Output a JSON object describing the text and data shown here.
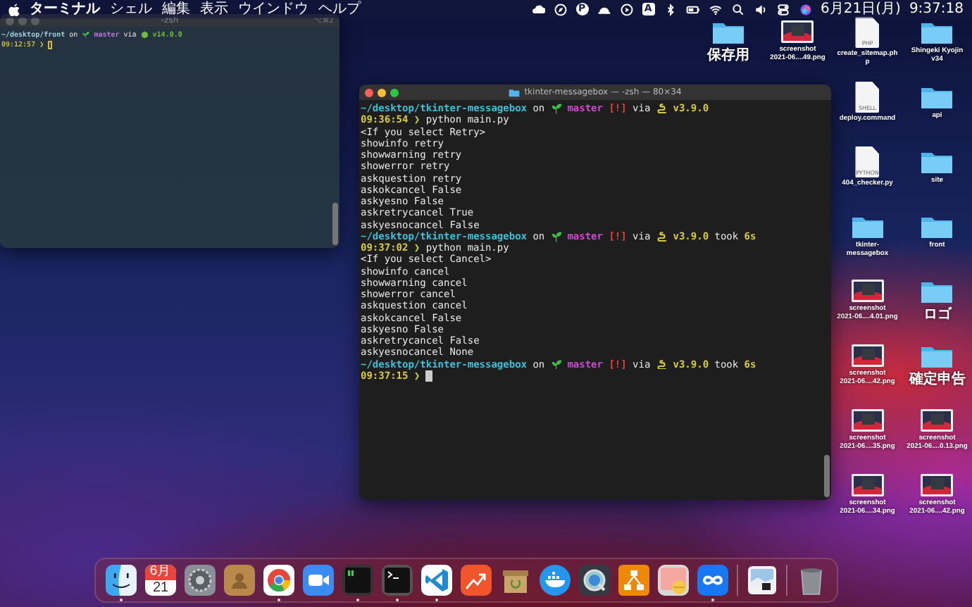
{
  "menubar": {
    "app": "ターミナル",
    "menus": [
      "シェル",
      "編集",
      "表示",
      "ウインドウ",
      "ヘルプ"
    ],
    "status_glyphs": [
      "P",
      "A"
    ],
    "date": "6月21日(月)",
    "time": "9:37:18"
  },
  "windows": [
    {
      "title": "-zsh",
      "shortcut": "⌥⌘2",
      "active": false,
      "lines": [
        [
          {
            "kind": "path",
            "text": "~/desktop/front"
          },
          {
            "kind": "plain",
            "text": "on"
          },
          {
            "kind": "sprout"
          },
          {
            "kind": "branch",
            "text": "master"
          },
          {
            "kind": "plain",
            "text": "via"
          },
          {
            "kind": "nodejs"
          },
          {
            "kind": "node",
            "text": "v14.0.0"
          }
        ],
        [
          {
            "kind": "time",
            "text": "09:12:57"
          },
          {
            "kind": "prompt",
            "text": "❯"
          },
          {
            "kind": "cursor"
          }
        ]
      ]
    },
    {
      "title": "tkinter-messagebox — -zsh — 80×34",
      "active": true,
      "lines": [
        [
          {
            "kind": "path",
            "text": "~/desktop/tkinter-messagebox"
          },
          {
            "kind": "plain",
            "text": "on"
          },
          {
            "kind": "sprout"
          },
          {
            "kind": "branch",
            "text": "master"
          },
          {
            "kind": "status",
            "text": "[!]"
          },
          {
            "kind": "plain",
            "text": "via"
          },
          {
            "kind": "python"
          },
          {
            "kind": "version",
            "text": "v3.9.0"
          }
        ],
        [
          {
            "kind": "time",
            "text": "09:36:54"
          },
          {
            "kind": "prompt",
            "text": "❯"
          },
          {
            "kind": "command",
            "text": "python main.py"
          }
        ],
        [
          {
            "kind": "output",
            "text": "<If you select Retry>"
          }
        ],
        [
          {
            "kind": "output",
            "text": "showinfo retry"
          }
        ],
        [
          {
            "kind": "output",
            "text": "showwarning retry"
          }
        ],
        [
          {
            "kind": "output",
            "text": "showerror retry"
          }
        ],
        [
          {
            "kind": "output",
            "text": "askquestion retry"
          }
        ],
        [
          {
            "kind": "output",
            "text": "askokcancel False"
          }
        ],
        [
          {
            "kind": "output",
            "text": "askyesno False"
          }
        ],
        [
          {
            "kind": "output",
            "text": "askretrycancel True"
          }
        ],
        [
          {
            "kind": "output",
            "text": "askyesnocancel False"
          }
        ],
        [
          {
            "kind": "path",
            "text": "~/desktop/tkinter-messagebox"
          },
          {
            "kind": "plain",
            "text": "on"
          },
          {
            "kind": "sprout"
          },
          {
            "kind": "branch",
            "text": "master"
          },
          {
            "kind": "status",
            "text": "[!]"
          },
          {
            "kind": "plain",
            "text": "via"
          },
          {
            "kind": "python"
          },
          {
            "kind": "version",
            "text": "v3.9.0"
          },
          {
            "kind": "plain",
            "text": "took"
          },
          {
            "kind": "duration",
            "text": "6s"
          }
        ],
        [
          {
            "kind": "time",
            "text": "09:37:02"
          },
          {
            "kind": "prompt",
            "text": "❯"
          },
          {
            "kind": "command",
            "text": "python main.py"
          }
        ],
        [
          {
            "kind": "output",
            "text": "<If you select Cancel>"
          }
        ],
        [
          {
            "kind": "output",
            "text": "showinfo cancel"
          }
        ],
        [
          {
            "kind": "output",
            "text": "showwarning cancel"
          }
        ],
        [
          {
            "kind": "output",
            "text": "showerror cancel"
          }
        ],
        [
          {
            "kind": "output",
            "text": "askquestion cancel"
          }
        ],
        [
          {
            "kind": "output",
            "text": "askokcancel False"
          }
        ],
        [
          {
            "kind": "output",
            "text": "askyesno False"
          }
        ],
        [
          {
            "kind": "output",
            "text": "askretrycancel False"
          }
        ],
        [
          {
            "kind": "output",
            "text": "askyesnocancel None"
          }
        ],
        [
          {
            "kind": "path",
            "text": "~/desktop/tkinter-messagebox"
          },
          {
            "kind": "plain",
            "text": "on"
          },
          {
            "kind": "sprout"
          },
          {
            "kind": "branch",
            "text": "master"
          },
          {
            "kind": "status",
            "text": "[!]"
          },
          {
            "kind": "plain",
            "text": "via"
          },
          {
            "kind": "python"
          },
          {
            "kind": "version",
            "text": "v3.9.0"
          },
          {
            "kind": "plain",
            "text": "took"
          },
          {
            "kind": "duration",
            "text": "6s"
          }
        ],
        [
          {
            "kind": "time",
            "text": "09:37:15"
          },
          {
            "kind": "prompt",
            "text": "❯"
          },
          {
            "kind": "cursor"
          }
        ]
      ]
    }
  ],
  "desktop_columns": [
    [
      {
        "kind": "folder",
        "label": [
          "保存用"
        ]
      }
    ],
    [
      {
        "kind": "image",
        "label": [
          "screenshot",
          "2021-06....49.png"
        ]
      }
    ],
    [
      {
        "kind": "document",
        "badge": "PHP",
        "label": [
          "create_sitemap.ph",
          "p"
        ]
      },
      {
        "kind": "document",
        "badge": "SHELL",
        "label": [
          "deploy.command"
        ]
      },
      {
        "kind": "document",
        "badge": "PYTHON",
        "label": [
          "404_checker.py"
        ]
      },
      {
        "kind": "folder",
        "label": [
          "tkinter-",
          "messagebox"
        ]
      },
      {
        "kind": "image",
        "label": [
          "screenshot",
          "2021-06....4.01.png"
        ]
      },
      {
        "kind": "image",
        "label": [
          "screenshot",
          "2021-06....42.png"
        ]
      },
      {
        "kind": "image",
        "label": [
          "screenshot",
          "2021-06....35.png"
        ]
      },
      {
        "kind": "image",
        "label": [
          "screenshot",
          "2021-06....34.png"
        ]
      }
    ],
    [
      {
        "kind": "folder",
        "label": [
          "Shingeki Kyojin",
          "v34"
        ]
      },
      {
        "kind": "folder",
        "label": [
          "api"
        ]
      },
      {
        "kind": "folder",
        "label": [
          "site"
        ]
      },
      {
        "kind": "folder",
        "label": [
          "front"
        ]
      },
      {
        "kind": "folder",
        "label": [
          "ロゴ"
        ]
      },
      {
        "kind": "folder",
        "label": [
          "確定申告"
        ]
      },
      {
        "kind": "image",
        "label": [
          "screenshot",
          "2021-06....0.13.png"
        ]
      },
      {
        "kind": "image",
        "label": [
          "screenshot",
          "2021-06....42.png"
        ]
      }
    ]
  ],
  "dock": [
    {
      "kind": "finder",
      "running": true
    },
    {
      "kind": "calendar",
      "month": "6月",
      "day": "21",
      "running": false
    },
    {
      "kind": "settings",
      "running": false
    },
    {
      "kind": "contacts",
      "running": false
    },
    {
      "kind": "chrome",
      "running": true
    },
    {
      "kind": "zoom",
      "running": false
    },
    {
      "kind": "console",
      "running": true
    },
    {
      "kind": "terminal",
      "running": true
    },
    {
      "kind": "vscode",
      "running": true
    },
    {
      "kind": "trend",
      "running": false
    },
    {
      "kind": "archive",
      "running": false
    },
    {
      "kind": "docker",
      "running": false
    },
    {
      "kind": "quicktime",
      "running": false
    },
    {
      "kind": "drawio",
      "running": false
    },
    {
      "kind": "pill",
      "running": false
    },
    {
      "kind": "infinity",
      "running": true
    },
    {
      "kind": "separator"
    },
    {
      "kind": "photo",
      "running": false
    },
    {
      "kind": "separator"
    },
    {
      "kind": "trash",
      "running": false
    }
  ]
}
